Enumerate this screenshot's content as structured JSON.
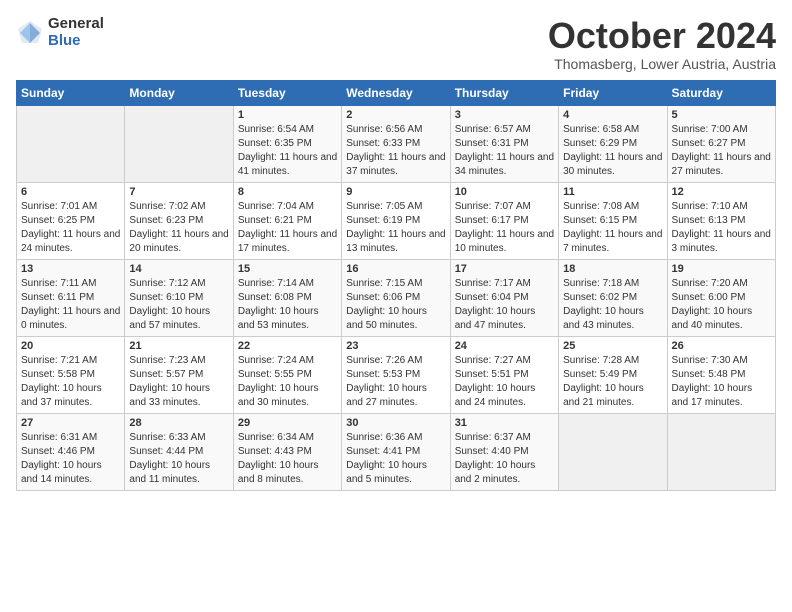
{
  "logo": {
    "general": "General",
    "blue": "Blue"
  },
  "header": {
    "month": "October 2024",
    "location": "Thomasberg, Lower Austria, Austria"
  },
  "weekdays": [
    "Sunday",
    "Monday",
    "Tuesday",
    "Wednesday",
    "Thursday",
    "Friday",
    "Saturday"
  ],
  "weeks": [
    [
      {
        "day": "",
        "info": ""
      },
      {
        "day": "",
        "info": ""
      },
      {
        "day": "1",
        "info": "Sunrise: 6:54 AM\nSunset: 6:35 PM\nDaylight: 11 hours and 41 minutes."
      },
      {
        "day": "2",
        "info": "Sunrise: 6:56 AM\nSunset: 6:33 PM\nDaylight: 11 hours and 37 minutes."
      },
      {
        "day": "3",
        "info": "Sunrise: 6:57 AM\nSunset: 6:31 PM\nDaylight: 11 hours and 34 minutes."
      },
      {
        "day": "4",
        "info": "Sunrise: 6:58 AM\nSunset: 6:29 PM\nDaylight: 11 hours and 30 minutes."
      },
      {
        "day": "5",
        "info": "Sunrise: 7:00 AM\nSunset: 6:27 PM\nDaylight: 11 hours and 27 minutes."
      }
    ],
    [
      {
        "day": "6",
        "info": "Sunrise: 7:01 AM\nSunset: 6:25 PM\nDaylight: 11 hours and 24 minutes."
      },
      {
        "day": "7",
        "info": "Sunrise: 7:02 AM\nSunset: 6:23 PM\nDaylight: 11 hours and 20 minutes."
      },
      {
        "day": "8",
        "info": "Sunrise: 7:04 AM\nSunset: 6:21 PM\nDaylight: 11 hours and 17 minutes."
      },
      {
        "day": "9",
        "info": "Sunrise: 7:05 AM\nSunset: 6:19 PM\nDaylight: 11 hours and 13 minutes."
      },
      {
        "day": "10",
        "info": "Sunrise: 7:07 AM\nSunset: 6:17 PM\nDaylight: 11 hours and 10 minutes."
      },
      {
        "day": "11",
        "info": "Sunrise: 7:08 AM\nSunset: 6:15 PM\nDaylight: 11 hours and 7 minutes."
      },
      {
        "day": "12",
        "info": "Sunrise: 7:10 AM\nSunset: 6:13 PM\nDaylight: 11 hours and 3 minutes."
      }
    ],
    [
      {
        "day": "13",
        "info": "Sunrise: 7:11 AM\nSunset: 6:11 PM\nDaylight: 11 hours and 0 minutes."
      },
      {
        "day": "14",
        "info": "Sunrise: 7:12 AM\nSunset: 6:10 PM\nDaylight: 10 hours and 57 minutes."
      },
      {
        "day": "15",
        "info": "Sunrise: 7:14 AM\nSunset: 6:08 PM\nDaylight: 10 hours and 53 minutes."
      },
      {
        "day": "16",
        "info": "Sunrise: 7:15 AM\nSunset: 6:06 PM\nDaylight: 10 hours and 50 minutes."
      },
      {
        "day": "17",
        "info": "Sunrise: 7:17 AM\nSunset: 6:04 PM\nDaylight: 10 hours and 47 minutes."
      },
      {
        "day": "18",
        "info": "Sunrise: 7:18 AM\nSunset: 6:02 PM\nDaylight: 10 hours and 43 minutes."
      },
      {
        "day": "19",
        "info": "Sunrise: 7:20 AM\nSunset: 6:00 PM\nDaylight: 10 hours and 40 minutes."
      }
    ],
    [
      {
        "day": "20",
        "info": "Sunrise: 7:21 AM\nSunset: 5:58 PM\nDaylight: 10 hours and 37 minutes."
      },
      {
        "day": "21",
        "info": "Sunrise: 7:23 AM\nSunset: 5:57 PM\nDaylight: 10 hours and 33 minutes."
      },
      {
        "day": "22",
        "info": "Sunrise: 7:24 AM\nSunset: 5:55 PM\nDaylight: 10 hours and 30 minutes."
      },
      {
        "day": "23",
        "info": "Sunrise: 7:26 AM\nSunset: 5:53 PM\nDaylight: 10 hours and 27 minutes."
      },
      {
        "day": "24",
        "info": "Sunrise: 7:27 AM\nSunset: 5:51 PM\nDaylight: 10 hours and 24 minutes."
      },
      {
        "day": "25",
        "info": "Sunrise: 7:28 AM\nSunset: 5:49 PM\nDaylight: 10 hours and 21 minutes."
      },
      {
        "day": "26",
        "info": "Sunrise: 7:30 AM\nSunset: 5:48 PM\nDaylight: 10 hours and 17 minutes."
      }
    ],
    [
      {
        "day": "27",
        "info": "Sunrise: 6:31 AM\nSunset: 4:46 PM\nDaylight: 10 hours and 14 minutes."
      },
      {
        "day": "28",
        "info": "Sunrise: 6:33 AM\nSunset: 4:44 PM\nDaylight: 10 hours and 11 minutes."
      },
      {
        "day": "29",
        "info": "Sunrise: 6:34 AM\nSunset: 4:43 PM\nDaylight: 10 hours and 8 minutes."
      },
      {
        "day": "30",
        "info": "Sunrise: 6:36 AM\nSunset: 4:41 PM\nDaylight: 10 hours and 5 minutes."
      },
      {
        "day": "31",
        "info": "Sunrise: 6:37 AM\nSunset: 4:40 PM\nDaylight: 10 hours and 2 minutes."
      },
      {
        "day": "",
        "info": ""
      },
      {
        "day": "",
        "info": ""
      }
    ]
  ]
}
